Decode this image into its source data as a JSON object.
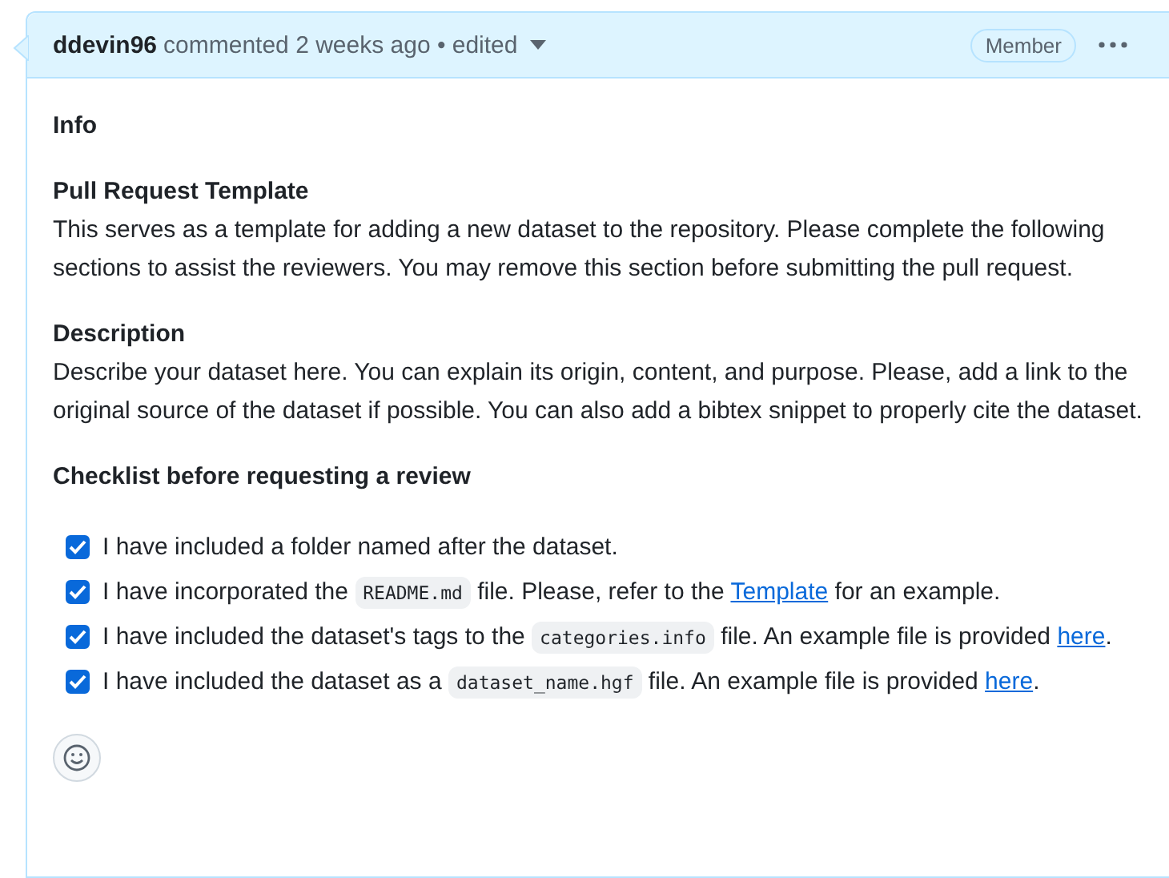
{
  "comment": {
    "author": "ddevin96",
    "meta": "commented 2 weeks ago • edited",
    "badge": "Member"
  },
  "sections": [
    {
      "heading": "Info"
    },
    {
      "heading": "Pull Request Template",
      "paragraphs": [
        "This serves as a template for adding a new dataset to the repository. Please complete the following sections to assist the reviewers. You may remove this section before submitting the pull request."
      ]
    },
    {
      "heading": "Description",
      "paragraphs": [
        "Describe your dataset here. You can explain its origin, content, and purpose. Please, add a link to the original source of the dataset if possible. You can also add a bibtex snippet to properly cite the dataset."
      ]
    }
  ],
  "checklist": {
    "heading": "Checklist before requesting a review",
    "items": [
      {
        "checked": true,
        "parts": [
          {
            "kind": "text",
            "text": "I have included a folder named after the dataset."
          }
        ]
      },
      {
        "checked": true,
        "parts": [
          {
            "kind": "text",
            "text": "I have incorporated the "
          },
          {
            "kind": "code",
            "text": "README.md"
          },
          {
            "kind": "text",
            "text": " file. Please, refer to the "
          },
          {
            "kind": "link",
            "text": "Template"
          },
          {
            "kind": "text",
            "text": " for an example."
          }
        ]
      },
      {
        "checked": true,
        "parts": [
          {
            "kind": "text",
            "text": "I have included the dataset's tags to the "
          },
          {
            "kind": "code",
            "text": "categories.info"
          },
          {
            "kind": "text",
            "text": " file. An example file is provided "
          },
          {
            "kind": "link",
            "text": "here"
          },
          {
            "kind": "text",
            "text": "."
          }
        ]
      },
      {
        "checked": true,
        "parts": [
          {
            "kind": "text",
            "text": "I have included the dataset as a "
          },
          {
            "kind": "code",
            "text": "dataset_name.hgf"
          },
          {
            "kind": "text",
            "text": " file. An example file is provided "
          },
          {
            "kind": "link",
            "text": "here"
          },
          {
            "kind": "text",
            "text": "."
          }
        ]
      }
    ]
  }
}
